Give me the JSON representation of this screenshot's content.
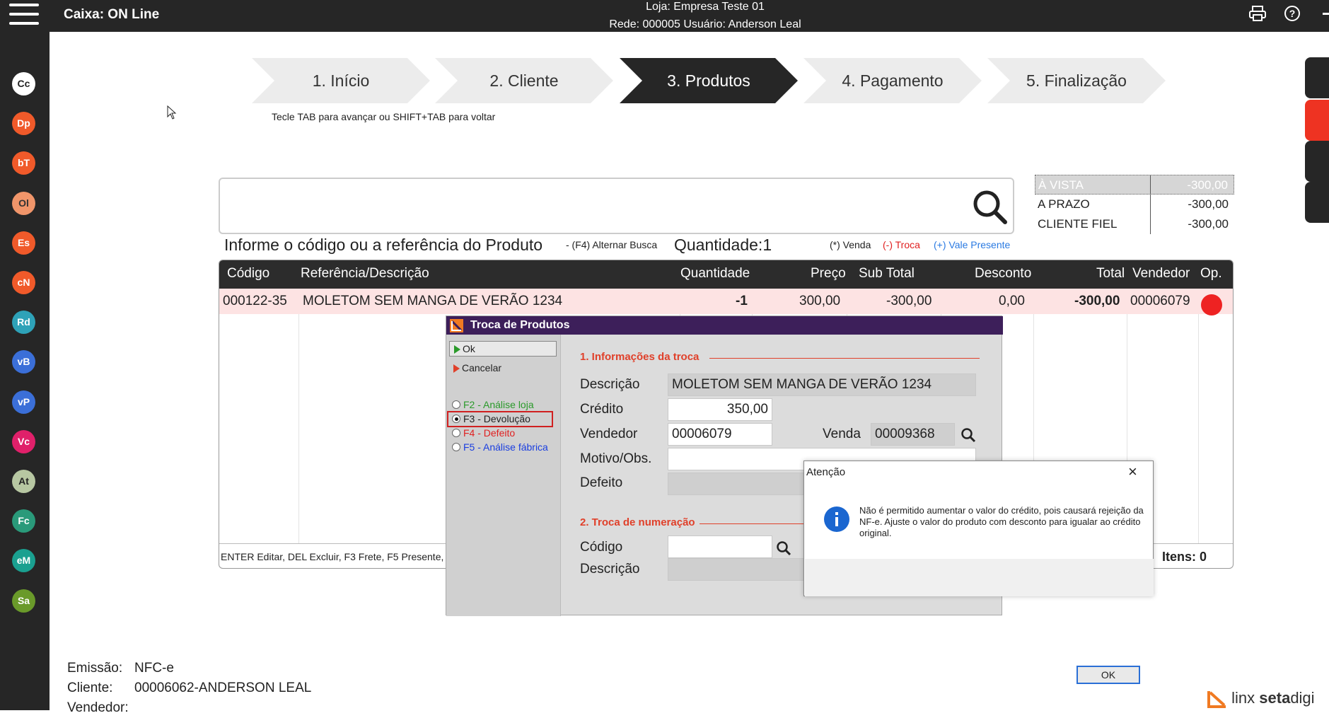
{
  "topbar": {
    "title": "Caixa: ON Line",
    "store": "Loja: Empresa Teste  01",
    "network": "Rede: 000005 Usuário: Anderson Leal",
    "print_icon": "printer-icon",
    "help_icon": "help-icon"
  },
  "sidebar": [
    {
      "label": "Cc",
      "color": "#ffffff",
      "fg": "#222222"
    },
    {
      "label": "Dp",
      "color": "#f05a2a",
      "fg": "#ffffff"
    },
    {
      "label": "bT",
      "color": "#f05a2a",
      "fg": "#ffffff"
    },
    {
      "label": "Ol",
      "color": "#f0956a",
      "fg": "#333333"
    },
    {
      "label": "Es",
      "color": "#f05a2a",
      "fg": "#ffffff"
    },
    {
      "label": "cN",
      "color": "#f05a2a",
      "fg": "#ffffff"
    },
    {
      "label": "Rd",
      "color": "#2ea2b8",
      "fg": "#ffffff"
    },
    {
      "label": "vB",
      "color": "#3b6fd8",
      "fg": "#ffffff"
    },
    {
      "label": "vP",
      "color": "#3b6fd8",
      "fg": "#ffffff"
    },
    {
      "label": "Vc",
      "color": "#e0206a",
      "fg": "#ffffff"
    },
    {
      "label": "At",
      "color": "#b7c7a2",
      "fg": "#222222"
    },
    {
      "label": "Fc",
      "color": "#2a9a7a",
      "fg": "#ffffff"
    },
    {
      "label": "eM",
      "color": "#1aa090",
      "fg": "#ffffff"
    },
    {
      "label": "Sa",
      "color": "#6a9a2a",
      "fg": "#ffffff"
    }
  ],
  "steps": [
    "1. Início",
    "2. Cliente",
    "3. Produtos",
    "4. Pagamento",
    "5. Finalização"
  ],
  "hint": "Tecle TAB para avançar ou SHIFT+TAB para voltar",
  "search": {
    "label": "Informe o código ou a referência do Produto",
    "alt": "- (F4) Alternar Busca",
    "qty_label": "Quantidade:",
    "qty": "1",
    "legend_venda": "(*) Venda",
    "legend_troca": "(-) Troca",
    "legend_presente": "(+) Vale Presente"
  },
  "prices": [
    {
      "label": "À VISTA",
      "value": "-300,00"
    },
    {
      "label": "A PRAZO",
      "value": "-300,00"
    },
    {
      "label": "CLIENTE FIEL",
      "value": "-300,00"
    }
  ],
  "grid": {
    "headers": [
      "Código",
      "Referência/Descrição",
      "Quantidade",
      "Preço",
      "Sub Total",
      "Desconto",
      "Total",
      "Vendedor",
      "Op."
    ],
    "row": {
      "codigo": "000122-35",
      "descricao": "MOLETOM SEM MANGA DE VERÃO 1234",
      "quantidade": "-1",
      "preco": "300,00",
      "subtotal": "-300,00",
      "desconto": "0,00",
      "total": "-300,00",
      "vendedor": "00006079"
    },
    "footer": "ENTER Editar, DEL Excluir, F3 Frete, F5 Presente, F",
    "itens": "Itens: 0"
  },
  "dialog": {
    "title": "Troca de Produtos",
    "ok": "Ok",
    "cancel": "Cancelar",
    "options": [
      "F2 - Análise loja",
      "F3 - Devolução",
      "F4 - Defeito",
      "F5 - Análise fábrica"
    ],
    "section1": "1. Informações da troca",
    "descricao_label": "Descrição",
    "descricao": "MOLETOM SEM MANGA DE VERÃO 1234",
    "credito_label": "Crédito",
    "credito": "350,00",
    "vendedor_label": "Vendedor",
    "vendedor": "00006079",
    "venda_label": "Venda",
    "venda": "00009368",
    "motivo_label": "Motivo/Obs.",
    "defeito_label": "Defeito",
    "section2": "2. Troca de numeração",
    "codigo_label": "Código",
    "descricao2_label": "Descrição"
  },
  "alert": {
    "title": "Atenção",
    "message": "Não é permitido aumentar o valor do crédito, pois causará rejeição da NF-e. Ajuste o valor do produto com desconto para igualar ao crédito original.",
    "ok": "OK"
  },
  "footer": {
    "emissao_label": "Emissão:",
    "emissao": "NFC-e",
    "cliente_label": "Cliente:",
    "cliente": "00006062-ANDERSON LEAL",
    "vendedor_label": "Vendedor:"
  },
  "brand": {
    "linx": "linx",
    "seta": "seta",
    "digi": "digi"
  }
}
